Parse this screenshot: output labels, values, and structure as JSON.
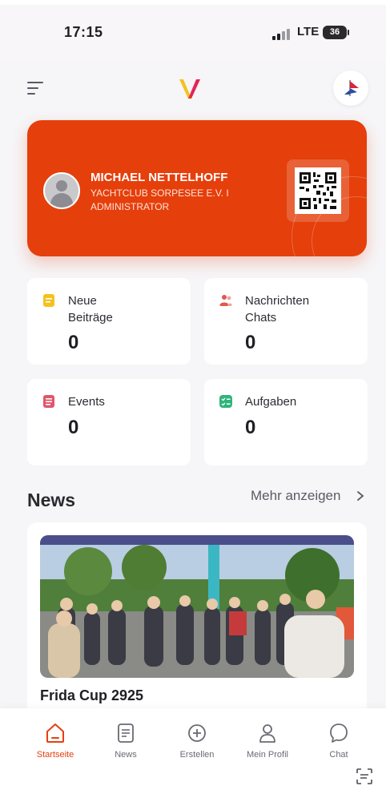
{
  "status_bar": {
    "time": "17:15",
    "network": "LTE",
    "battery": "36"
  },
  "app_bar": {
    "menu_icon": "menu-icon",
    "logo": "app-logo",
    "club_burgee": "club-burgee-icon"
  },
  "member_card": {
    "name": "MICHAEL NETTELHOFF",
    "club": "YACHTCLUB SORPESEE E.V. I",
    "role": "ADMINISTRATOR",
    "accent_color": "#e53f0c",
    "qr_icon": "qr-code-icon"
  },
  "stats": [
    {
      "label_line1": "Neue",
      "label_line2": "Beiträge",
      "value": "0",
      "icon": "posts-icon",
      "color": "#f4c21f"
    },
    {
      "label_line1": "Nachrichten",
      "label_line2": "Chats",
      "value": "0",
      "icon": "people-icon",
      "color": "#e2584e"
    },
    {
      "label_line1": "Events",
      "value": "0",
      "icon": "events-icon",
      "color": "#e0566b"
    },
    {
      "label_line1": "Aufgaben",
      "value": "0",
      "icon": "tasks-icon",
      "color": "#2fb57a"
    }
  ],
  "news": {
    "title": "News",
    "more_label": "Mehr anzeigen",
    "items": [
      {
        "title": "Frida Cup 2925"
      }
    ]
  },
  "bottom_nav": [
    {
      "label": "Startseite",
      "icon": "home-icon",
      "active": true
    },
    {
      "label": "News",
      "icon": "news-icon"
    },
    {
      "label": "Erstellen",
      "icon": "plus-circle-icon"
    },
    {
      "label": "Mein Profil",
      "icon": "profile-icon"
    },
    {
      "label": "Chat",
      "icon": "chat-icon"
    }
  ]
}
